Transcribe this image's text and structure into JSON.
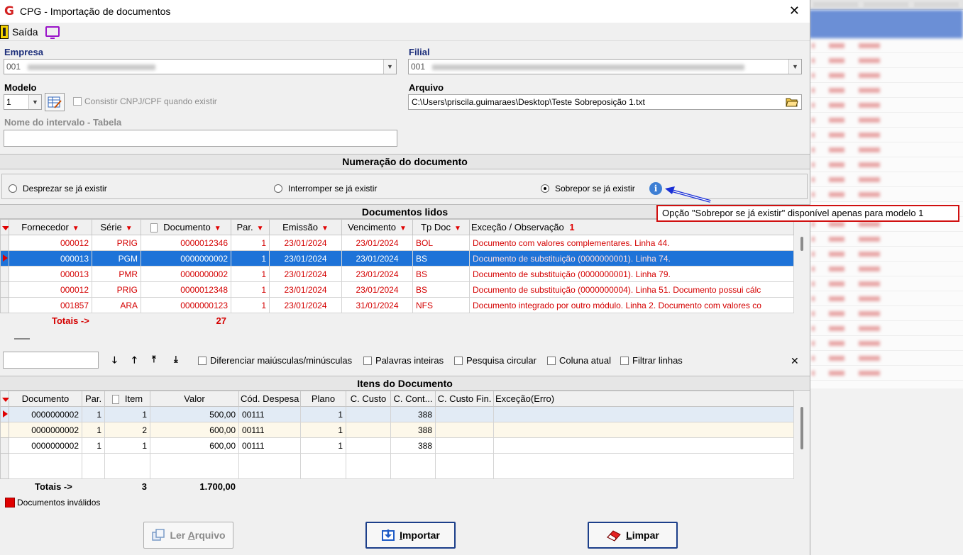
{
  "window": {
    "title": "CPG - Importação de documentos",
    "logo_glyph": "G",
    "close_glyph": "✕"
  },
  "menu": {
    "exit_label": "Saída"
  },
  "empresa": {
    "label": "Empresa",
    "value": "001"
  },
  "filial": {
    "label": "Filial",
    "value": "001"
  },
  "modelo": {
    "label": "Modelo",
    "value": "1",
    "consistir_label": "Consistir CNPJ/CPF quando existir"
  },
  "arquivo": {
    "label": "Arquivo",
    "value": "C:\\Users\\priscila.guimaraes\\Desktop\\Teste Sobreposição 1.txt"
  },
  "intervalo": {
    "label": "Nome do intervalo - Tabela",
    "value": ""
  },
  "numeracao": {
    "header": "Numeração do documento",
    "options": [
      "Desprezar se já existir",
      "Interromper se já existir",
      "Sobrepor se já existir"
    ],
    "selected": "Sobrepor se já existir",
    "info_glyph": "i"
  },
  "tooltip": "Opção \"Sobrepor se já existir\" disponível apenas para modelo 1",
  "docs": {
    "header": "Documentos lidos",
    "columns": [
      "Fornecedor",
      "Série",
      "Documento",
      "Par.",
      "Emissão",
      "Vencimento",
      "Tp Doc",
      "Exceção / Observação"
    ],
    "sort_glyph": "1",
    "rows": [
      [
        "000012",
        "PRIG",
        "0000012346",
        "1",
        "23/01/2024",
        "23/01/2024",
        "BOL",
        "Documento com valores complementares. Linha 44."
      ],
      [
        "000013",
        "PGM",
        "0000000002",
        "1",
        "23/01/2024",
        "23/01/2024",
        "BS",
        "Documento de substituição (0000000001). Linha 74."
      ],
      [
        "000013",
        "PMR",
        "0000000002",
        "1",
        "23/01/2024",
        "23/01/2024",
        "BS",
        "Documento de substituição (0000000001). Linha 79."
      ],
      [
        "000012",
        "PRIG",
        "0000012348",
        "1",
        "23/01/2024",
        "23/01/2024",
        "BS",
        "Documento de substituição (0000000004). Linha 51. Documento possui cálc"
      ],
      [
        "001857",
        "ARA",
        "0000000123",
        "1",
        "23/01/2024",
        "31/01/2024",
        "NFS",
        "Documento integrado por outro módulo. Linha 2. Documento com valores co"
      ]
    ],
    "totals_label": "Totais ->",
    "totals_value": "27"
  },
  "search": {
    "nav": [
      "🡓",
      "🡑",
      "⤒",
      "⤓"
    ],
    "options": [
      "Diferenciar maiúsculas/minúsculas",
      "Palavras inteiras",
      "Pesquisa circular",
      "Coluna atual",
      "Filtrar linhas"
    ],
    "close_glyph": "✕"
  },
  "items": {
    "header": "Itens do Documento",
    "columns": [
      "Documento",
      "Par.",
      "Item",
      "Valor",
      "Cód. Despesa",
      "Plano",
      "C. Custo",
      "C. Cont...",
      "C. Custo Fin.",
      "Exceção(Erro)"
    ],
    "rows": [
      [
        "0000000002",
        "1",
        "1",
        "500,00",
        "00111",
        "1",
        "",
        "388",
        "",
        ""
      ],
      [
        "0000000002",
        "1",
        "2",
        "600,00",
        "00111",
        "1",
        "",
        "388",
        "",
        ""
      ],
      [
        "0000000002",
        "1",
        "1",
        "600,00",
        "00111",
        "1",
        "",
        "388",
        "",
        ""
      ]
    ],
    "totals_label": "Totais ->",
    "totals_count": "3",
    "totals_value": "1.700,00"
  },
  "legend": {
    "invalid_label": "Documentos inválidos",
    "color": "#e00000"
  },
  "buttons": {
    "ler": {
      "prefix": "Ler ",
      "key": "A",
      "rest": "rquivo"
    },
    "importar": {
      "key": "I",
      "rest": "mportar"
    },
    "limpar": {
      "key": "L",
      "rest": "impar"
    }
  },
  "colors": {
    "selection": "#1e73d8",
    "error_text": "#d40000",
    "tooltip_border": "#d01010"
  }
}
